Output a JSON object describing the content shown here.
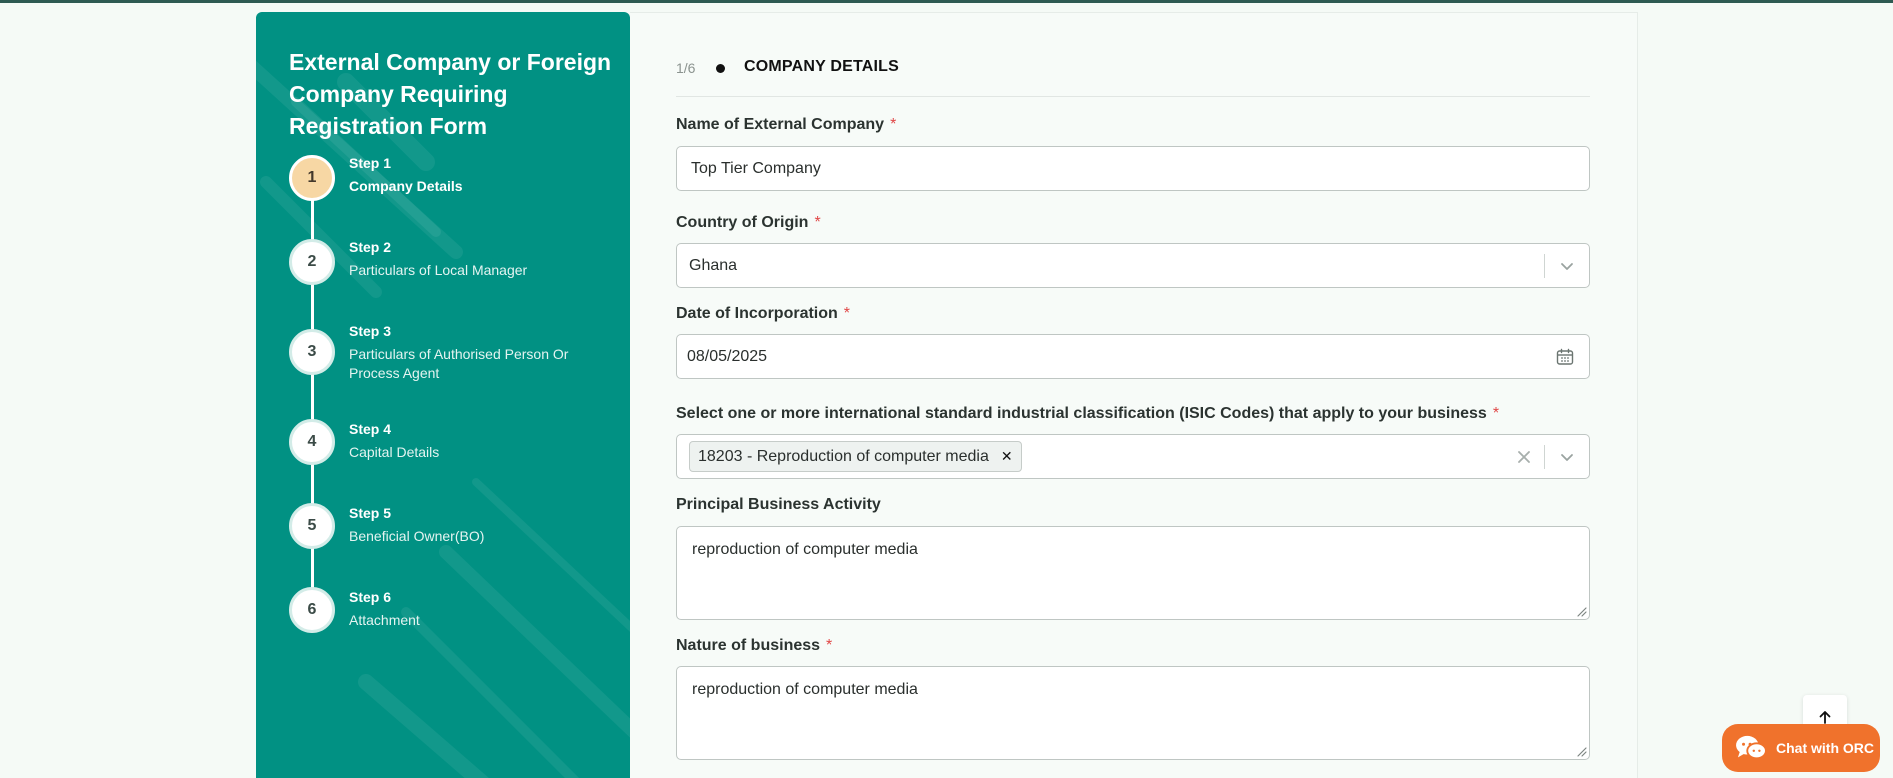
{
  "sidebar": {
    "title": "External Company or Foreign Company Requiring Registration Form",
    "steps": [
      {
        "number": "1",
        "step": "Step 1",
        "label": "Company Details",
        "active": true
      },
      {
        "number": "2",
        "step": "Step 2",
        "label": "Particulars of Local Manager",
        "active": false
      },
      {
        "number": "3",
        "step": "Step 3",
        "label": "Particulars of Authorised Person Or Process Agent",
        "active": false
      },
      {
        "number": "4",
        "step": "Step 4",
        "label": "Capital Details",
        "active": false
      },
      {
        "number": "5",
        "step": "Step 5",
        "label": "Beneficial Owner(BO)",
        "active": false
      },
      {
        "number": "6",
        "step": "Step 6",
        "label": "Attachment",
        "active": false
      }
    ]
  },
  "progress": {
    "count": "1/6",
    "title": "COMPANY DETAILS"
  },
  "form": {
    "company_name": {
      "label": "Name of External Company",
      "required": "*",
      "value": "Top Tier Company"
    },
    "country": {
      "label": "Country of Origin",
      "required": "*",
      "value": "Ghana"
    },
    "incorporation_date": {
      "label": "Date of Incorporation",
      "required": "*",
      "value": "08/05/2025"
    },
    "isic": {
      "label": "Select one or more international standard industrial classification (ISIC Codes) that apply to your business",
      "required": "*",
      "selected": [
        "18203 - Reproduction of computer media"
      ]
    },
    "principal_activity": {
      "label": "Principal Business Activity",
      "value": "reproduction of computer media"
    },
    "nature_of_business": {
      "label": "Nature of business",
      "required": "*",
      "value": "reproduction of computer media"
    }
  },
  "chat": {
    "label": "Chat with ORC"
  },
  "colors": {
    "sidebar": "#019183",
    "active_step": "#f7d7a4",
    "chat": "#f0722c",
    "required": "#e04646"
  }
}
